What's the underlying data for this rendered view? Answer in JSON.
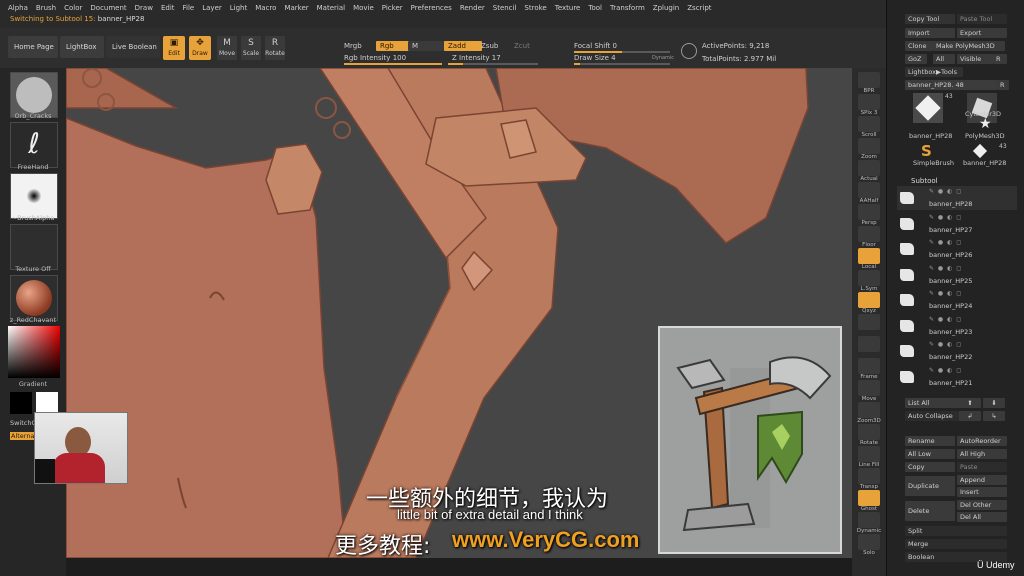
{
  "menu": [
    "Alpha",
    "Brush",
    "Color",
    "Document",
    "Draw",
    "Edit",
    "File",
    "Layer",
    "Light",
    "Macro",
    "Marker",
    "Material",
    "Movie",
    "Picker",
    "Preferences",
    "Render",
    "Stencil",
    "Stroke",
    "Texture",
    "Tool",
    "Transform",
    "Zplugin",
    "Zscript"
  ],
  "status": {
    "prefix": "Switching to Subtool 15:",
    "value": "banner_HP28"
  },
  "toolbar": {
    "home_page": "Home Page",
    "lightbox": "LightBox",
    "live_boolean": "Live Boolean",
    "edit": "Edit",
    "draw": "Draw",
    "move": "Move",
    "scale": "Scale",
    "rotate": "Rotate",
    "mrgb": "Mrgb",
    "rgb": "Rgb",
    "m": "M",
    "zadd": "Zadd",
    "zsub": "Zsub",
    "zcut": "Zcut",
    "rgb_intensity": "Rgb Intensity",
    "rgb_intensity_value": "100",
    "z_intensity": "Z Intensity",
    "z_intensity_value": "17",
    "focal_shift": "Focal Shift",
    "focal_shift_value": "0",
    "draw_size": "Draw Size",
    "draw_size_value": "4",
    "dynamic": "Dynamic",
    "active_points": "ActivePoints: 9,218",
    "total_points": "TotalPoints: 2.977 Mil",
    "rgb_intensity_pct": 100,
    "z_intensity_pct": 17,
    "focal_shift_pct": 50,
    "draw_size_pct": 6
  },
  "left_panel": {
    "brush": "Orb_Cracks",
    "stroke": "FreeHand",
    "alpha": "~BrushAlpha",
    "texture": "Texture Off",
    "material": "z_RedChavant",
    "gradient": "Gradient",
    "switch": "SwitchC",
    "alternate": "Alterna"
  },
  "right_column": [
    "BPR",
    "SPix 3",
    "Scroll",
    "Zoom",
    "Actual",
    "AAHalf",
    "Persp",
    "Floor",
    "Local",
    "L.Sym",
    "Qxyz",
    "",
    "",
    "Frame",
    "Move",
    "Zoom3D",
    "Rotate",
    "Line Fill PolyF",
    "Transp",
    "Ghost",
    "Dynamic",
    "Solo"
  ],
  "tool_panel": {
    "copy_tool": "Copy Tool",
    "paste_tool": "Paste Tool",
    "import": "Import",
    "export": "Export",
    "clone": "Clone",
    "make_polymesh": "Make PolyMesh3D",
    "goz": "GoZ",
    "all": "All",
    "visible": "Visible",
    "r": "R",
    "lightbox_tools": "Lightbox▶Tools",
    "current_tool": "banner_HP28. 48",
    "r2": "R",
    "thumb1_name": "banner_HP28",
    "thumb1_count": "43",
    "thumb2_name": "Cylinder3D",
    "thumb3_name": "PolyMesh3D",
    "thumb4_name": "SimpleBrush",
    "thumb5_name": "banner_HP28",
    "thumb5_count": "43",
    "subtool": "Subtool",
    "subtools": [
      "banner_HP28",
      "banner_HP27",
      "banner_HP26",
      "banner_HP25",
      "banner_HP24",
      "banner_HP23",
      "banner_HP22",
      "banner_HP21"
    ],
    "list_all": "List All",
    "auto_collapse": "Auto Collapse",
    "rename": "Rename",
    "autoreorder": "AutoReorder",
    "all_low": "All Low",
    "all_high": "All High",
    "copy": "Copy",
    "paste": "Paste",
    "duplicate": "Duplicate",
    "append": "Append",
    "insert": "Insert",
    "delete": "Delete",
    "del_other": "Del Other",
    "del_all": "Del All",
    "split": "Split",
    "merge": "Merge",
    "boolean": "Boolean"
  },
  "subtitles": {
    "chinese": "一些额外的细节，我认为",
    "english": "little bit of extra detail and I think",
    "watermark_cn": "更多教程:",
    "watermark_url": "www.VeryCG.com"
  },
  "branding": {
    "udemy": "Udemy"
  },
  "colors": {
    "accent": "#e8a23a",
    "clay": "#b8735a",
    "viewport": "#464646",
    "watermark": "#f0a020"
  }
}
